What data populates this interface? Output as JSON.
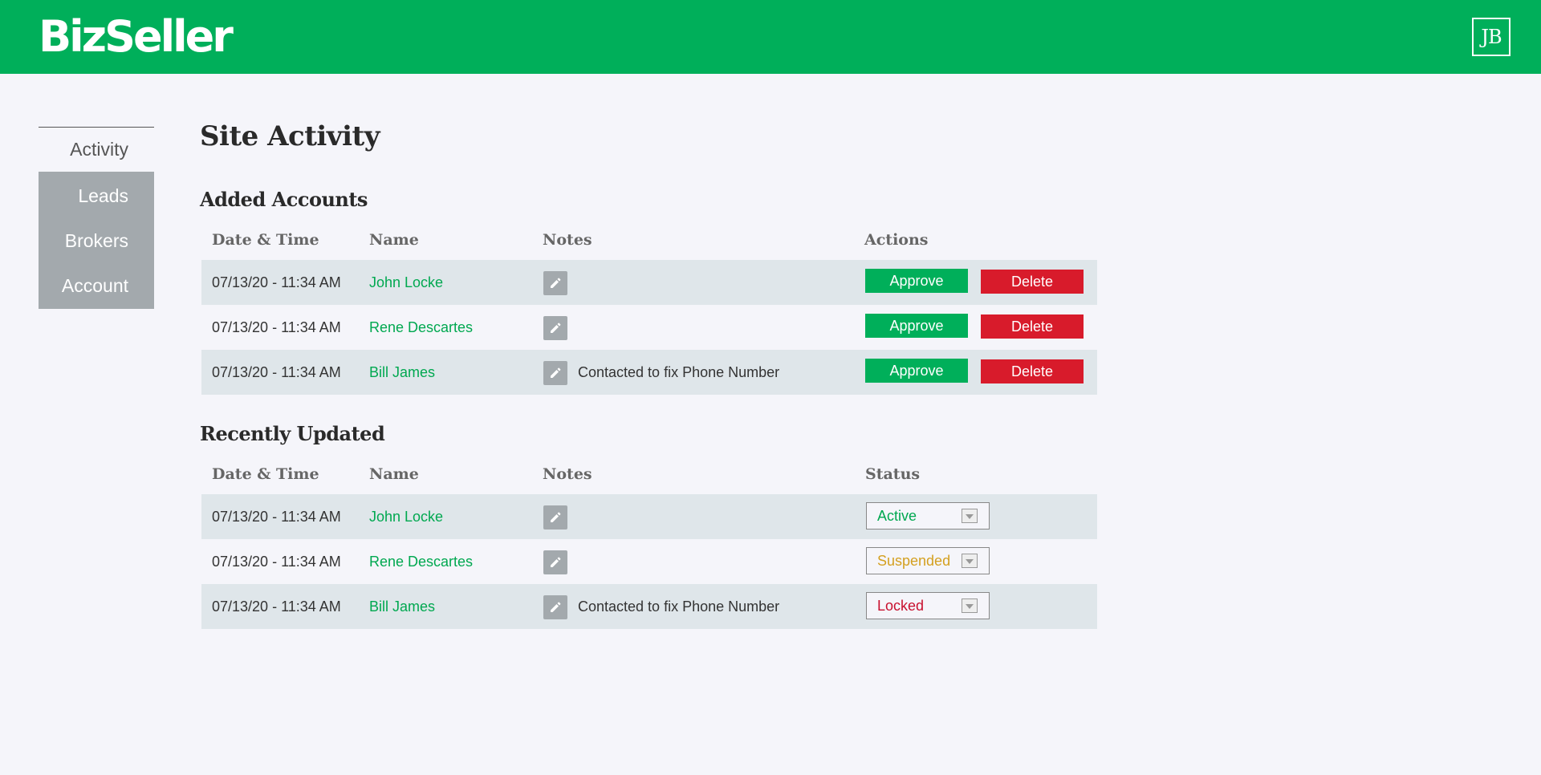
{
  "header": {
    "logo": "BizSeller",
    "avatar_initials": "JB",
    "brand_color": "#00af5a"
  },
  "sidebar": {
    "items": [
      {
        "label": "Activity"
      },
      {
        "label": "Leads"
      },
      {
        "label": "Brokers"
      },
      {
        "label": "Account"
      }
    ]
  },
  "page": {
    "title": "Site Activity"
  },
  "added_accounts": {
    "title": "Added Accounts",
    "columns": [
      "Date & Time",
      "Name",
      "Notes",
      "Actions"
    ],
    "approve_label": "Approve",
    "delete_label": "Delete",
    "rows": [
      {
        "datetime": "07/13/20 - 11:34 AM",
        "name": "John Locke",
        "note": ""
      },
      {
        "datetime": "07/13/20 - 11:34 AM",
        "name": "Rene Descartes",
        "note": ""
      },
      {
        "datetime": "07/13/20 - 11:34 AM",
        "name": "Bill James",
        "note": "Contacted to fix Phone Number"
      }
    ]
  },
  "recently_updated": {
    "title": "Recently Updated",
    "columns": [
      "Date & Time",
      "Name",
      "Notes",
      "Status"
    ],
    "rows": [
      {
        "datetime": "07/13/20 - 11:34 AM",
        "name": "John Locke",
        "note": "",
        "status": "Active",
        "status_color": "#00a850"
      },
      {
        "datetime": "07/13/20 - 11:34 AM",
        "name": "Rene Descartes",
        "note": "",
        "status": "Suspended",
        "status_color": "#d4a020"
      },
      {
        "datetime": "07/13/20 - 11:34 AM",
        "name": "Bill James",
        "note": "Contacted to fix Phone Number",
        "status": "Locked",
        "status_color": "#c8102e"
      }
    ]
  },
  "icons": {
    "edit": "pencil-icon",
    "dropdown": "chevron-down-icon"
  }
}
